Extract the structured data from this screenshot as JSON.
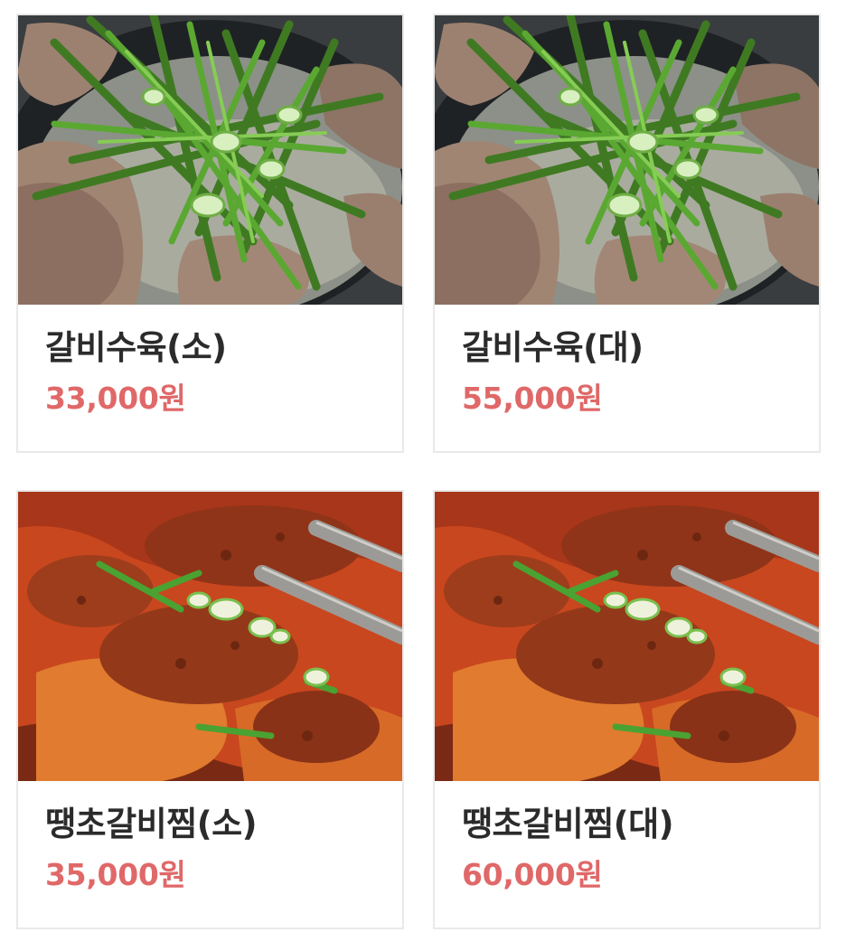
{
  "menu": {
    "items": [
      {
        "name": "갈비수육(소)",
        "price": "33,000원",
        "photo": "galbi-suyuk-photo"
      },
      {
        "name": "갈비수육(대)",
        "price": "55,000원",
        "photo": "galbi-suyuk-photo"
      },
      {
        "name": "땡초갈비찜(소)",
        "price": "35,000원",
        "photo": "ttaengcho-galbijjim-photo"
      },
      {
        "name": "땡초갈비찜(대)",
        "price": "60,000원",
        "photo": "ttaengcho-galbijjim-photo"
      }
    ]
  },
  "colors": {
    "price": "#e06868",
    "name": "#2b2b2b",
    "border": "#e9e9e9"
  }
}
